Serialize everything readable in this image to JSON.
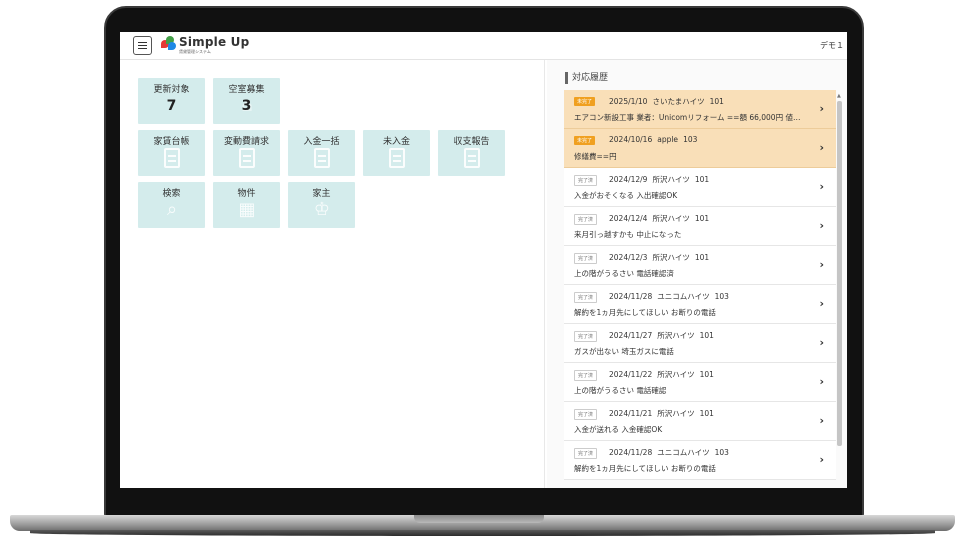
{
  "header": {
    "brand_name": "Simple Up",
    "brand_sub": "賃貸管理システム",
    "user_label": "デモ１",
    "user_caret": "▾"
  },
  "tiles": [
    {
      "label": "更新対象",
      "count": "7",
      "kind": "count"
    },
    {
      "label": "空室募集",
      "count": "3",
      "kind": "count"
    },
    {
      "label": "家賃台帳",
      "icon": "ledger-icon"
    },
    {
      "label": "変動費請求",
      "icon": "invoice-icon"
    },
    {
      "label": "入金一括",
      "icon": "bulk-payment-icon"
    },
    {
      "label": "未入金",
      "icon": "unpaid-icon"
    },
    {
      "label": "収支報告",
      "icon": "report-icon"
    },
    {
      "label": "検索",
      "icon": "search-icon"
    },
    {
      "label": "物件",
      "icon": "building-icon"
    },
    {
      "label": "家主",
      "icon": "owner-icon"
    }
  ],
  "history": {
    "title": "対応履歴",
    "items": [
      {
        "status": "未完了",
        "state": "pending",
        "date": "2025/1/10",
        "property": "さいたまハイツ",
        "room": "101",
        "body": "エアコン新設工事 業者：Unicomリフォーム ==額 66,000円 値下げ..."
      },
      {
        "status": "未完了",
        "state": "pending",
        "date": "2024/10/16",
        "property": "apple",
        "room": "103",
        "body": "修繕費==円"
      },
      {
        "status": "完了済",
        "state": "done",
        "date": "2024/12/9",
        "property": "所沢ハイツ",
        "room": "101",
        "body": "入金がおそくなる 入出確認OK"
      },
      {
        "status": "完了済",
        "state": "done",
        "date": "2024/12/4",
        "property": "所沢ハイツ",
        "room": "101",
        "body": "来月引っ越すかも 中止になった"
      },
      {
        "status": "完了済",
        "state": "done",
        "date": "2024/12/3",
        "property": "所沢ハイツ",
        "room": "101",
        "body": "上の階がうるさい 電話確認済"
      },
      {
        "status": "完了済",
        "state": "done",
        "date": "2024/11/28",
        "property": "ユニコムハイツ",
        "room": "103",
        "body": "解約を1ヵ月先にしてほしい お断りの電話"
      },
      {
        "status": "完了済",
        "state": "done",
        "date": "2024/11/27",
        "property": "所沢ハイツ",
        "room": "101",
        "body": "ガスが出ない 埼玉ガスに電話"
      },
      {
        "status": "完了済",
        "state": "done",
        "date": "2024/11/22",
        "property": "所沢ハイツ",
        "room": "101",
        "body": "上の階がうるさい 電話確認"
      },
      {
        "status": "完了済",
        "state": "done",
        "date": "2024/11/21",
        "property": "所沢ハイツ",
        "room": "101",
        "body": "入金が送れる 入金確認OK"
      },
      {
        "status": "完了済",
        "state": "done",
        "date": "2024/11/28",
        "property": "ユニコムハイツ",
        "room": "103",
        "body": "解約を1ヵ月先にしてほしい お断りの電話"
      }
    ]
  },
  "glyphs": {
    "chevron": "›",
    "scroll_up": "▲",
    "search_glyph": "⌕",
    "building_glyph": "▦",
    "owner_glyph": "♔",
    "vacancy_glyph": "⌂"
  },
  "colors": {
    "tile_bg": "#d4ecec",
    "pending_badge": "#f0a020",
    "pending_row": "#f9dfb8"
  }
}
